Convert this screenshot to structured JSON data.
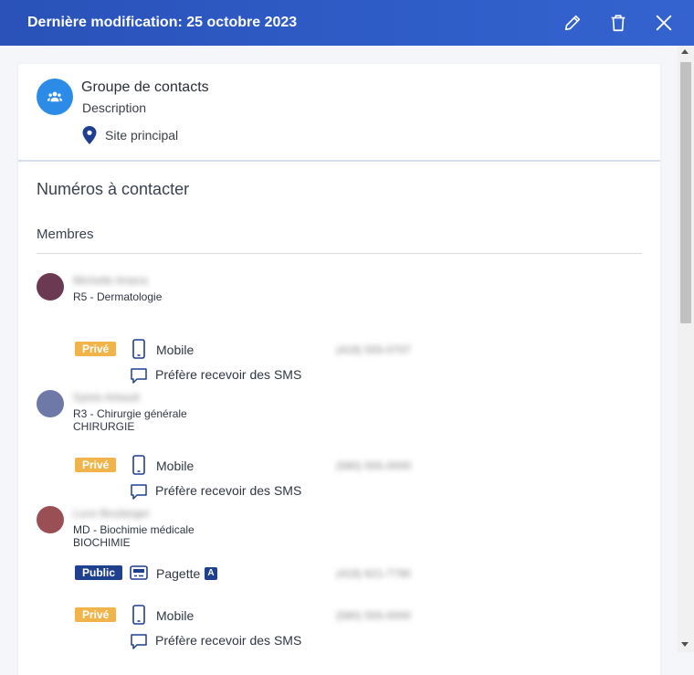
{
  "header": {
    "title": "Dernière modification: 25 octobre 2023",
    "edit_icon": "pencil-icon",
    "delete_icon": "trash-icon",
    "close_icon": "close-icon"
  },
  "group": {
    "name": "Groupe de contacts",
    "description": "Description",
    "site": "Site principal",
    "avatar_color": "#2b8be6"
  },
  "section_title": "Numéros à contacter",
  "members_title": "Membres",
  "members": [
    {
      "name": "Michelle Ariana",
      "role": "R5 - Dermatologie",
      "department": "",
      "avatar_color": "#6b3a52",
      "contacts": [
        {
          "visibility": "Privé",
          "type": "Mobile",
          "number": "(418) 555-0707",
          "prefers_sms": "Préfère recevoir des SMS"
        }
      ]
    },
    {
      "name": "Sylvie Arbault",
      "role": "R3 - Chirurgie générale",
      "department": "CHIRURGIE",
      "avatar_color": "#6e79a8",
      "contacts": [
        {
          "visibility": "Privé",
          "type": "Mobile",
          "number": "(580) 555-0000",
          "prefers_sms": "Préfère recevoir des SMS"
        }
      ]
    },
    {
      "name": "Luce Boulanger",
      "role": "MD - Biochimie médicale",
      "department": "BIOCHIMIE",
      "avatar_color": "#9a4f55",
      "contacts": [
        {
          "visibility": "Public",
          "type": "Pagette",
          "pager_flag": "A",
          "number": "(418) 621-7790"
        },
        {
          "visibility": "Privé",
          "type": "Mobile",
          "number": "(580) 555-0000",
          "prefers_sms": "Préfère recevoir des SMS"
        }
      ]
    }
  ],
  "colors": {
    "header_bg": "#2f5dc8",
    "private_badge": "#f0b44a",
    "public_badge": "#1f3f8f",
    "icon_blue": "#1f3f8f"
  }
}
